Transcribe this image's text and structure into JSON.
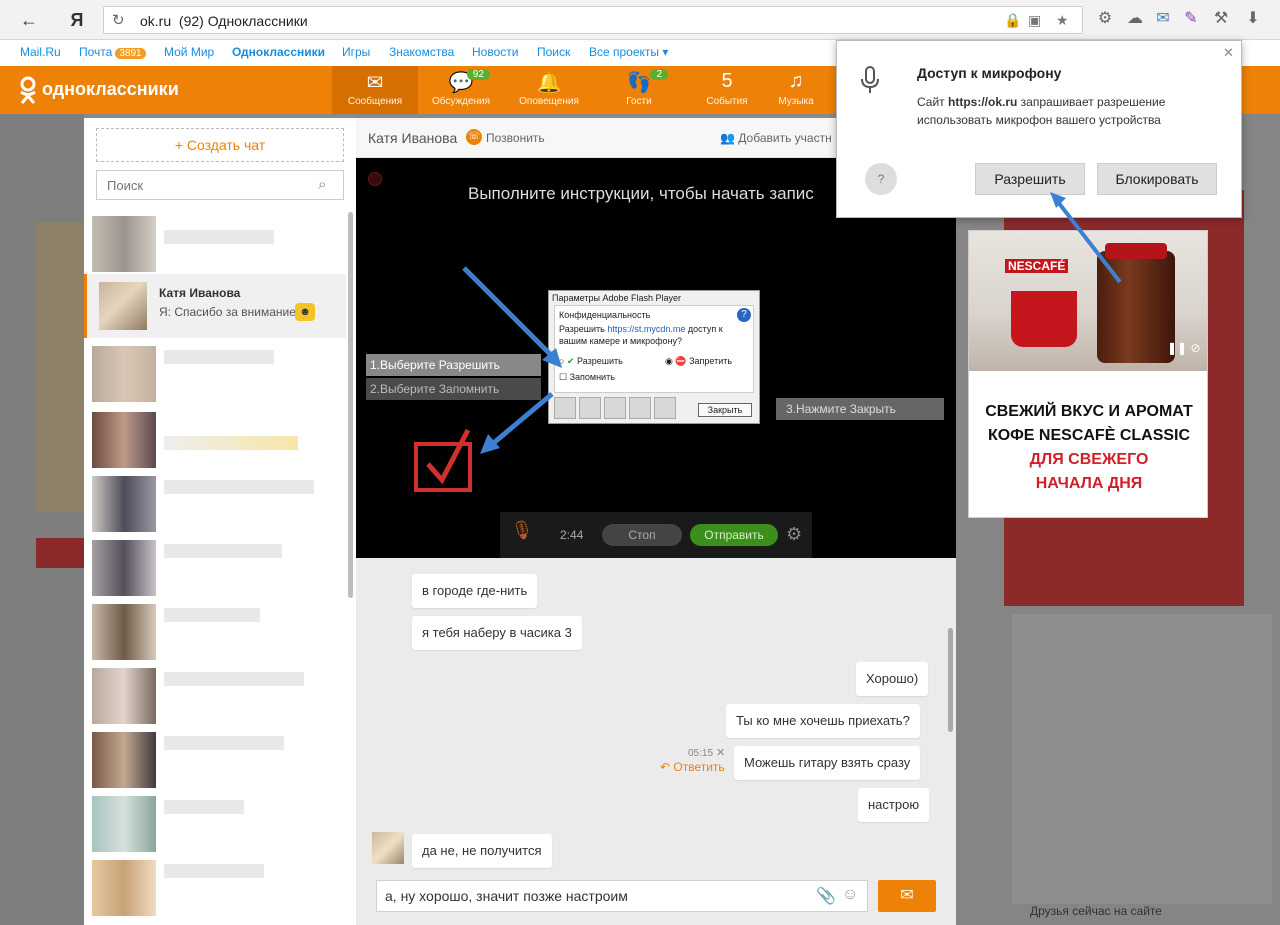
{
  "browser": {
    "back_glyph": "←",
    "home_glyph": "Я",
    "reload_glyph": "↻",
    "url_domain": "ok.ru",
    "page_title": "(92) Одноклассники",
    "download_glyph": "⬇"
  },
  "mailbar": {
    "items": [
      "Mail.Ru",
      "Почта",
      "Мой Мир",
      "Одноклассники",
      "Игры",
      "Знакомства",
      "Новости",
      "Поиск",
      "Все проекты ▾"
    ],
    "mail_badge": "3891"
  },
  "header": {
    "logo_text": "одноклассники",
    "tabs": [
      {
        "label": "Сообщения",
        "icon": "✉",
        "badge": ""
      },
      {
        "label": "Обсуждения",
        "icon": "💬",
        "badge": "92"
      },
      {
        "label": "Оповещения",
        "icon": "🔔",
        "badge": ""
      },
      {
        "label": "Гости",
        "icon": "👣",
        "badge": "2"
      },
      {
        "label": "События",
        "icon": "5",
        "badge": ""
      },
      {
        "label": "Музыка",
        "icon": "♫",
        "badge": ""
      }
    ]
  },
  "chatlist": {
    "create_label": "+ Создать чат",
    "search_placeholder": "Поиск",
    "selected": {
      "name": "Катя Иванова",
      "last_message": "Я: Спасибо за внимание"
    }
  },
  "conversation": {
    "name": "Катя Иванова",
    "call_label": "Позвонить",
    "add_participant": "Добавить участн",
    "video": {
      "instruction": "Выполните инструкции, чтобы начать запис",
      "step1": "1.Выберите Разрешить",
      "step2": "2.Выберите Запомнить",
      "step3": "3.Нажмите Закрыть",
      "timer": "2:44",
      "stop_label": "Стоп",
      "send_label": "Отправить",
      "flash": {
        "title": "Параметры Adobe Flash Player",
        "section": "Конфиденциальность",
        "line1_a": "Разрешить ",
        "line1_link": "https://st.mycdn.me",
        "line1_b": " доступ к",
        "line2": "вашим камере и микрофону?",
        "allow": "Разрешить",
        "deny": "Запретить",
        "remember": "Запомнить",
        "close": "Закрыть"
      }
    },
    "messages": {
      "in1": "в городе где-нить",
      "in2": "я тебя наберу в часика 3",
      "out1": "Хорошо)",
      "out2": "Ты ко мне хочешь приехать?",
      "out3": "Можешь гитару взять сразу",
      "out4": "настрою",
      "out3_time": "05:15",
      "reply_label": "Ответить",
      "in3": "да не, не получится"
    },
    "input_value": "а, ну хорошо, значит позже настроим"
  },
  "permission": {
    "title": "Доступ к микрофону",
    "text_a": "Сайт ",
    "text_site": "https://ok.ru",
    "text_b": " запрашивает разрешение использовать микрофон вашего устройства",
    "help": "?",
    "allow": "Разрешить",
    "block": "Блокировать",
    "close": "✕"
  },
  "ad": {
    "brand": "NESCAFÉ",
    "line1": "СВЕЖИЙ ВКУС И АРОМАТ",
    "line2": "КОФЕ NESCAFÈ CLASSIC",
    "line3": "ДЛЯ СВЕЖЕГО",
    "line4": "НАЧАЛА ДНЯ"
  },
  "sidebar_right": {
    "friends_online": "Друзья сейчас на сайте"
  },
  "colors": {
    "ok_orange": "#ee8208",
    "mail_blue": "#168de2",
    "badge_green": "#5bb02b",
    "arrow_blue": "#3d7fd1"
  }
}
